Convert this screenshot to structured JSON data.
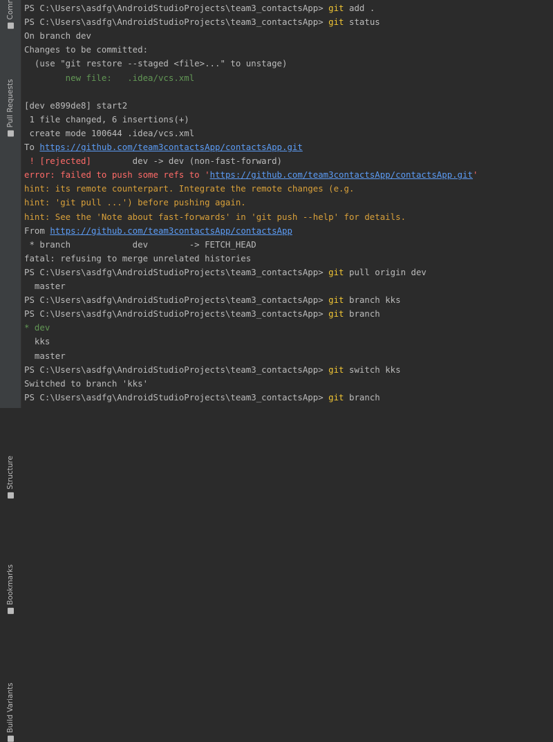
{
  "sidebar": {
    "tabs": [
      "Comm",
      "Pull Requests",
      "Structure",
      "Bookmarks",
      "Build Variants"
    ]
  },
  "terminal": {
    "prompt": "PS C:\\Users\\asdfg\\AndroidStudioProjects\\team3_contactsApp>",
    "lines": [
      [
        {
          "t": "PS C:\\Users\\asdfg\\AndroidStudioProjects\\team3_contactsApp> ",
          "c": ""
        },
        {
          "t": "git",
          "c": "cmd"
        },
        {
          "t": " add .",
          "c": ""
        }
      ],
      [
        {
          "t": "PS C:\\Users\\asdfg\\AndroidStudioProjects\\team3_contactsApp> ",
          "c": ""
        },
        {
          "t": "git",
          "c": "cmd"
        },
        {
          "t": " status",
          "c": ""
        }
      ],
      [
        {
          "t": "On branch dev",
          "c": ""
        }
      ],
      [
        {
          "t": "Changes to be committed:",
          "c": ""
        }
      ],
      [
        {
          "t": "  (use \"git restore --staged <file>...\" to unstage)",
          "c": ""
        }
      ],
      [
        {
          "t": "        new file:   .idea/vcs.xml",
          "c": "green"
        }
      ],
      [
        {
          "t": "",
          "c": ""
        }
      ],
      [
        {
          "t": "[dev e899de8] start2",
          "c": ""
        }
      ],
      [
        {
          "t": " 1 file changed, 6 insertions(+)",
          "c": ""
        }
      ],
      [
        {
          "t": " create mode 100644 .idea/vcs.xml",
          "c": ""
        }
      ],
      [
        {
          "t": "To ",
          "c": ""
        },
        {
          "t": "https://github.com/team3contactsApp/contactsApp.git",
          "c": "link"
        }
      ],
      [
        {
          "t": " ! [rejected]        dev -> dev (non-fast-forward)",
          "c": "errmix"
        }
      ],
      [
        {
          "t": "error: failed to push some refs to '",
          "c": "err"
        },
        {
          "t": "https://github.com/team3contactsApp/contactsApp.git",
          "c": "link"
        },
        {
          "t": "'",
          "c": "err"
        }
      ],
      [
        {
          "t": "hint: its remote counterpart. Integrate the remote changes (e.g.",
          "c": "hint"
        }
      ],
      [
        {
          "t": "hint: 'git pull ...') before pushing again.",
          "c": "hint"
        }
      ],
      [
        {
          "t": "hint: See the 'Note about fast-forwards' in 'git push --help' for details.",
          "c": "hint"
        }
      ],
      [
        {
          "t": "From ",
          "c": ""
        },
        {
          "t": "https://github.com/team3contactsApp/contactsApp",
          "c": "link"
        }
      ],
      [
        {
          "t": " * branch            dev        -> FETCH_HEAD",
          "c": ""
        }
      ],
      [
        {
          "t": "fatal: refusing to merge unrelated histories",
          "c": ""
        }
      ],
      [
        {
          "t": "PS C:\\Users\\asdfg\\AndroidStudioProjects\\team3_contactsApp> ",
          "c": ""
        },
        {
          "t": "git",
          "c": "cmd"
        },
        {
          "t": " pull origin dev",
          "c": ""
        }
      ],
      [
        {
          "t": "  master",
          "c": ""
        }
      ],
      [
        {
          "t": "PS C:\\Users\\asdfg\\AndroidStudioProjects\\team3_contactsApp> ",
          "c": ""
        },
        {
          "t": "git",
          "c": "cmd"
        },
        {
          "t": " branch kks",
          "c": ""
        }
      ],
      [
        {
          "t": "PS C:\\Users\\asdfg\\AndroidStudioProjects\\team3_contactsApp> ",
          "c": ""
        },
        {
          "t": "git",
          "c": "cmd"
        },
        {
          "t": " branch",
          "c": ""
        }
      ],
      [
        {
          "t": "* dev",
          "c": "green"
        }
      ],
      [
        {
          "t": "  kks",
          "c": ""
        }
      ],
      [
        {
          "t": "  master",
          "c": ""
        }
      ],
      [
        {
          "t": "PS C:\\Users\\asdfg\\AndroidStudioProjects\\team3_contactsApp> ",
          "c": ""
        },
        {
          "t": "git",
          "c": "cmd"
        },
        {
          "t": " switch kks",
          "c": ""
        }
      ],
      [
        {
          "t": "Switched to branch 'kks'",
          "c": ""
        }
      ],
      [
        {
          "t": "PS C:\\Users\\asdfg\\AndroidStudioProjects\\team3_contactsApp> ",
          "c": ""
        },
        {
          "t": "git",
          "c": "cmd"
        },
        {
          "t": " branch",
          "c": ""
        }
      ]
    ]
  },
  "colors": {
    "background": "#2b2b2b",
    "text": "#bbbbbb",
    "command": "#f0c534",
    "green": "#629755",
    "error": "#ff6b68",
    "hint": "#d8a03a",
    "link": "#5c9cf5"
  }
}
